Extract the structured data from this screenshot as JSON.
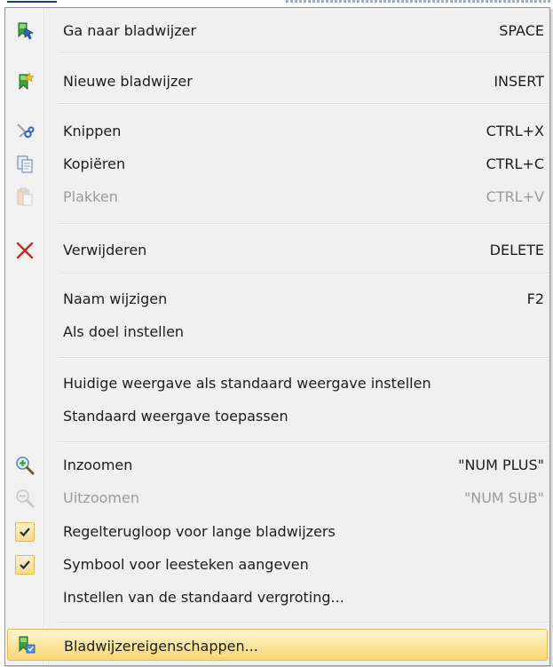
{
  "menu": {
    "items": [
      {
        "label": "Ga naar bladwijzer",
        "shortcut": "SPACE",
        "icon": "goto-bookmark-icon"
      },
      {
        "label": "Nieuwe bladwijzer",
        "shortcut": "INSERT",
        "icon": "new-bookmark-icon"
      },
      {
        "label": "Knippen",
        "shortcut": "CTRL+X",
        "icon": "scissors-icon"
      },
      {
        "label": "Kopiëren",
        "shortcut": "CTRL+C",
        "icon": "copy-icon"
      },
      {
        "label": "Plakken",
        "shortcut": "CTRL+V",
        "icon": "paste-icon",
        "disabled": true
      },
      {
        "label": "Verwijderen",
        "shortcut": "DELETE",
        "icon": "delete-x-icon"
      },
      {
        "label": "Naam wijzigen",
        "shortcut": "F2"
      },
      {
        "label": "Als doel instellen",
        "shortcut": ""
      },
      {
        "label": "Huidige weergave als standaard weergave instellen",
        "shortcut": ""
      },
      {
        "label": "Standaard weergave toepassen",
        "shortcut": ""
      },
      {
        "label": "Inzoomen",
        "shortcut": "\"NUM PLUS\"",
        "icon": "zoom-in-icon"
      },
      {
        "label": "Uitzoomen",
        "shortcut": "\"NUM SUB\"",
        "icon": "zoom-out-icon",
        "disabled": true
      },
      {
        "label": "Regelterugloop voor lange bladwijzers",
        "shortcut": "",
        "checked": true
      },
      {
        "label": "Symbool voor leesteken aangeven",
        "shortcut": "",
        "checked": true
      },
      {
        "label": "Instellen van de standaard vergroting...",
        "shortcut": ""
      },
      {
        "label": "Bladwijzereigenschappen...",
        "shortcut": "",
        "icon": "bookmark-properties-icon",
        "highlighted": true
      }
    ]
  },
  "colors": {
    "menu_bg": "#f0f0f0",
    "highlight_border": "#e6b84d",
    "highlight_fill": "#fbe59a",
    "delete_red": "#c62828",
    "disabled_text": "#9a9a9a"
  }
}
